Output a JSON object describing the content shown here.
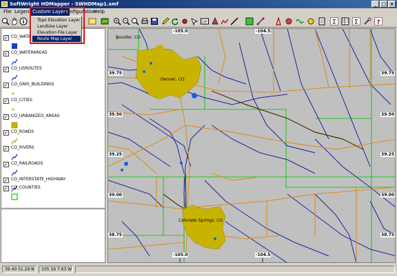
{
  "window": {
    "title": "SoftWright HDMapper - SWHDMap1.smf",
    "buttons": [
      "_",
      "□",
      "×"
    ]
  },
  "menubar": {
    "file": "File",
    "legend": "Legend",
    "custom_layers": "Custom Layers",
    "configuration": "Configuration",
    "help": "Help"
  },
  "dropdown": {
    "items": [
      "Topo Elevation Layer",
      "LandUse Layer",
      "Elevation File Layer",
      "Route Map Layer"
    ],
    "selected_index": 3
  },
  "legend": {
    "layers": [
      {
        "name": "CO_WATERBODIES",
        "symbol": "square-blue"
      },
      {
        "name": "CO_WATERAREAS",
        "symbol": "line-blue"
      },
      {
        "name": "CO_USROUTES",
        "symbol": "line-blue"
      },
      {
        "name": "CO_GNIS_BUILDINGS",
        "symbol": "dot-yellow"
      },
      {
        "name": "CO_CITIES",
        "symbol": "dot-yellow"
      },
      {
        "name": "CO_URBANIZED_AREAS",
        "symbol": "square-yellow"
      },
      {
        "name": "CO_ROADS",
        "symbol": "line-orange"
      },
      {
        "name": "CO_RIVERS",
        "symbol": "line-blue"
      },
      {
        "name": "CO_RAILROADS",
        "symbol": "line-blue"
      },
      {
        "name": "CO_INTERSTATE_HIGHWAY",
        "symbol": "line-blue"
      },
      {
        "name": "CO_COUNTIES",
        "symbol": "square-green"
      }
    ]
  },
  "map": {
    "cities": [
      "Boulder, CO",
      "Denver, CO",
      "Colorado Springs, CO"
    ],
    "grid_labels": {
      "lat_left": [
        "39.75",
        "39.50",
        "39.25",
        "39.00",
        "38.75"
      ],
      "lat_right": [
        "39.75",
        "39.50",
        "39.25",
        "39.00",
        "38.75"
      ],
      "lon_top": [
        "-105.0",
        "-104.5"
      ],
      "lon_bottom": [
        "-105.0",
        "-104.5"
      ]
    },
    "colors": {
      "background": "#c0c0c0",
      "urban": "#c8b400",
      "roads": "#e08a10",
      "rivers": "#2020a0",
      "counties": "#20c820",
      "water": "#1860e0"
    }
  },
  "status": {
    "lat": "39 40 51.29 N",
    "lon": "105 19 7.63 W"
  }
}
